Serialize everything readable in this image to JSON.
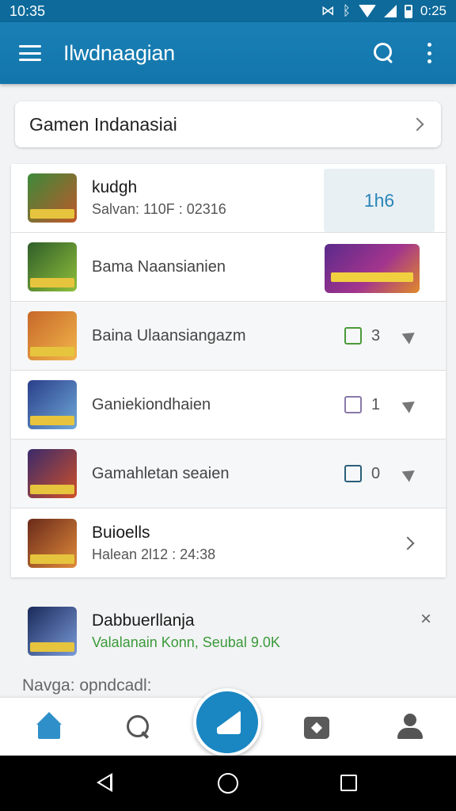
{
  "status_bar": {
    "time": "10:35",
    "clock_right": "0:25"
  },
  "app_bar": {
    "title": "Ilwdnaagian"
  },
  "category": {
    "label": "Gamen Indanasiai"
  },
  "list": [
    {
      "title": "kudgh",
      "subtitle": "Salvan: 110F : 02316",
      "box_text": "1h6",
      "thumb_colors": [
        "#3c8a3a",
        "#c0572a"
      ]
    },
    {
      "title": "Bama Naansianien",
      "thumb_colors": [
        "#2f5e2a",
        "#8fbf3a"
      ]
    },
    {
      "title": "Baina Ulaansiangazm",
      "count": "3",
      "check_color": "#4a9a3a",
      "thumb_colors": [
        "#c7682a",
        "#f2b54a"
      ]
    },
    {
      "title": "Ganiekiondhaien",
      "count": "1",
      "check_color": "#8a7aa8",
      "thumb_colors": [
        "#2a3f8a",
        "#6ea8d8"
      ]
    },
    {
      "title": "Gamahletan seaien",
      "count": "0",
      "check_color": "#2a5f7a",
      "thumb_colors": [
        "#3a2a6a",
        "#d0502a"
      ]
    },
    {
      "title": "Buioells",
      "subtitle": "Halean 2l12 : 24:38",
      "thumb_colors": [
        "#6a2a1a",
        "#e08a3a"
      ]
    }
  ],
  "notification": {
    "title": "Dabbuerllanja",
    "subtitle": "Valalanain Konn, Seubal 9.0K",
    "close_icon": "×",
    "thumb_colors": [
      "#1a2a5a",
      "#7a9ad8"
    ]
  },
  "footer_text": "Navga: opndcadl:"
}
